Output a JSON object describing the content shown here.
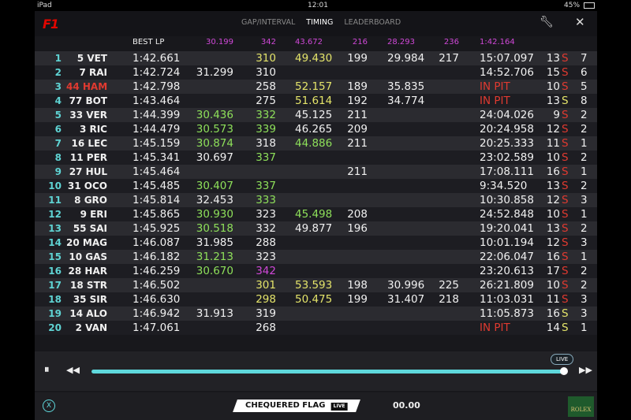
{
  "status": {
    "device": "iPad",
    "time": "12:01",
    "battery": "45%"
  },
  "header": {
    "logo": "F1",
    "tabs": [
      "GAP/INTERVAL",
      "TIMING",
      "LEADERBOARD"
    ],
    "active_tab": "TIMING"
  },
  "columns": {
    "best": "BEST LP",
    "s1": "30.199",
    "sp1": "342",
    "s2": "43.672",
    "sp2": "216",
    "s3": "28.293",
    "sp3": "236",
    "last": "1:42.164"
  },
  "colors": {
    "white": "#f0f0f0",
    "green": "#8ee05a",
    "yellow": "#e4e46a",
    "purple": "#d048d8",
    "red": "#e03a30",
    "accent": "#5fd8dc"
  },
  "rows": [
    {
      "pos": "1",
      "drv": "5 VET",
      "best": "1:42.661",
      "s1": [
        "",
        ""
      ],
      "sp1": [
        "310",
        "yellow"
      ],
      "s2": [
        "49.430",
        "yellow"
      ],
      "sp2": "199",
      "s3": "29.984",
      "sp3": "217",
      "last": [
        "15:07.097",
        "white"
      ],
      "laps": "13",
      "tyre": [
        "S",
        "red"
      ],
      "stint": "7"
    },
    {
      "pos": "2",
      "drv": "7 RAI",
      "best": "1:42.724",
      "s1": [
        "31.299",
        "white"
      ],
      "sp1": [
        "310",
        "white"
      ],
      "s2": [
        "",
        ""
      ],
      "sp2": "",
      "s3": "",
      "sp3": "",
      "last": [
        "14:52.706",
        "white"
      ],
      "laps": "15",
      "tyre": [
        "S",
        "red"
      ],
      "stint": "6"
    },
    {
      "pos": "3",
      "drv": "44 HAM",
      "drv_color": "red",
      "best": "1:42.798",
      "s1": [
        "",
        ""
      ],
      "sp1": [
        "258",
        "white"
      ],
      "s2": [
        "52.157",
        "yellow"
      ],
      "sp2": "189",
      "s3": "35.835",
      "sp3": "",
      "last": [
        "IN PIT",
        "red"
      ],
      "laps": "10",
      "tyre": [
        "S",
        "red"
      ],
      "stint": "5"
    },
    {
      "pos": "4",
      "drv": "77 BOT",
      "best": "1:43.464",
      "s1": [
        "",
        ""
      ],
      "sp1": [
        "275",
        "white"
      ],
      "s2": [
        "51.614",
        "yellow"
      ],
      "sp2": "192",
      "s3": "34.774",
      "sp3": "",
      "last": [
        "IN PIT",
        "red"
      ],
      "laps": "13",
      "tyre": [
        "S",
        "yellow"
      ],
      "stint": "8"
    },
    {
      "pos": "5",
      "drv": "33 VER",
      "best": "1:44.399",
      "s1": [
        "30.436",
        "green"
      ],
      "sp1": [
        "332",
        "green"
      ],
      "s2": [
        "45.125",
        "white"
      ],
      "sp2": "211",
      "s3": "",
      "sp3": "",
      "last": [
        "24:04.026",
        "white"
      ],
      "laps": "9",
      "tyre": [
        "S",
        "red"
      ],
      "stint": "2"
    },
    {
      "pos": "6",
      "drv": "3 RIC",
      "best": "1:44.479",
      "s1": [
        "30.573",
        "green"
      ],
      "sp1": [
        "339",
        "green"
      ],
      "s2": [
        "46.265",
        "white"
      ],
      "sp2": "209",
      "s3": "",
      "sp3": "",
      "last": [
        "20:24.958",
        "white"
      ],
      "laps": "12",
      "tyre": [
        "S",
        "red"
      ],
      "stint": "2"
    },
    {
      "pos": "7",
      "drv": "16 LEC",
      "best": "1:45.159",
      "s1": [
        "30.874",
        "green"
      ],
      "sp1": [
        "318",
        "white"
      ],
      "s2": [
        "44.886",
        "green"
      ],
      "sp2": "211",
      "s3": "",
      "sp3": "",
      "last": [
        "20:25.333",
        "white"
      ],
      "laps": "11",
      "tyre": [
        "S",
        "red"
      ],
      "stint": "1"
    },
    {
      "pos": "8",
      "drv": "11 PER",
      "best": "1:45.341",
      "s1": [
        "30.697",
        "white"
      ],
      "sp1": [
        "337",
        "green"
      ],
      "s2": [
        "",
        ""
      ],
      "sp2": "",
      "s3": "",
      "sp3": "",
      "last": [
        "23:02.589",
        "white"
      ],
      "laps": "10",
      "tyre": [
        "S",
        "red"
      ],
      "stint": "2"
    },
    {
      "pos": "9",
      "drv": "27 HUL",
      "best": "1:45.464",
      "s1": [
        "",
        ""
      ],
      "sp1": [
        "",
        ""
      ],
      "s2": [
        "",
        ""
      ],
      "sp2": "211",
      "s3": "",
      "sp3": "",
      "last": [
        "17:08.111",
        "white"
      ],
      "laps": "16",
      "tyre": [
        "S",
        "red"
      ],
      "stint": "1"
    },
    {
      "pos": "10",
      "drv": "31 OCO",
      "best": "1:45.485",
      "s1": [
        "30.407",
        "green"
      ],
      "sp1": [
        "337",
        "green"
      ],
      "s2": [
        "",
        ""
      ],
      "sp2": "",
      "s3": "",
      "sp3": "",
      "last": [
        "9:34.520",
        "white"
      ],
      "laps": "13",
      "tyre": [
        "S",
        "red"
      ],
      "stint": "2"
    },
    {
      "pos": "11",
      "drv": "8 GRO",
      "best": "1:45.814",
      "s1": [
        "32.453",
        "white"
      ],
      "sp1": [
        "333",
        "green"
      ],
      "s2": [
        "",
        ""
      ],
      "sp2": "",
      "s3": "",
      "sp3": "",
      "last": [
        "10:30.858",
        "white"
      ],
      "laps": "12",
      "tyre": [
        "S",
        "red"
      ],
      "stint": "3"
    },
    {
      "pos": "12",
      "drv": "9 ERI",
      "best": "1:45.865",
      "s1": [
        "30.930",
        "green"
      ],
      "sp1": [
        "323",
        "white"
      ],
      "s2": [
        "45.498",
        "green"
      ],
      "sp2": "208",
      "s3": "",
      "sp3": "",
      "last": [
        "24:52.848",
        "white"
      ],
      "laps": "10",
      "tyre": [
        "S",
        "red"
      ],
      "stint": "1"
    },
    {
      "pos": "13",
      "drv": "55 SAI",
      "best": "1:45.925",
      "s1": [
        "30.518",
        "green"
      ],
      "sp1": [
        "332",
        "white"
      ],
      "s2": [
        "49.877",
        "white"
      ],
      "sp2": "196",
      "s3": "",
      "sp3": "",
      "last": [
        "19:20.041",
        "white"
      ],
      "laps": "13",
      "tyre": [
        "S",
        "red"
      ],
      "stint": "2"
    },
    {
      "pos": "14",
      "drv": "20 MAG",
      "best": "1:46.087",
      "s1": [
        "31.985",
        "white"
      ],
      "sp1": [
        "288",
        "white"
      ],
      "s2": [
        "",
        ""
      ],
      "sp2": "",
      "s3": "",
      "sp3": "",
      "last": [
        "10:01.194",
        "white"
      ],
      "laps": "12",
      "tyre": [
        "S",
        "red"
      ],
      "stint": "3"
    },
    {
      "pos": "15",
      "drv": "10 GAS",
      "best": "1:46.182",
      "s1": [
        "31.213",
        "green"
      ],
      "sp1": [
        "323",
        "white"
      ],
      "s2": [
        "",
        ""
      ],
      "sp2": "",
      "s3": "",
      "sp3": "",
      "last": [
        "22:06.047",
        "white"
      ],
      "laps": "16",
      "tyre": [
        "S",
        "red"
      ],
      "stint": "1"
    },
    {
      "pos": "16",
      "drv": "28 HAR",
      "best": "1:46.259",
      "s1": [
        "30.670",
        "green"
      ],
      "sp1": [
        "342",
        "purple"
      ],
      "s2": [
        "",
        ""
      ],
      "sp2": "",
      "s3": "",
      "sp3": "",
      "last": [
        "23:20.613",
        "white"
      ],
      "laps": "17",
      "tyre": [
        "S",
        "red"
      ],
      "stint": "2"
    },
    {
      "pos": "17",
      "drv": "18 STR",
      "best": "1:46.502",
      "s1": [
        "",
        ""
      ],
      "sp1": [
        "301",
        "yellow"
      ],
      "s2": [
        "53.593",
        "yellow"
      ],
      "sp2": "198",
      "s3": "30.996",
      "sp3": "225",
      "last": [
        "26:21.809",
        "white"
      ],
      "laps": "10",
      "tyre": [
        "S",
        "red"
      ],
      "stint": "2"
    },
    {
      "pos": "18",
      "drv": "35 SIR",
      "best": "1:46.630",
      "s1": [
        "",
        ""
      ],
      "sp1": [
        "298",
        "yellow"
      ],
      "s2": [
        "50.475",
        "yellow"
      ],
      "sp2": "199",
      "s3": "31.407",
      "sp3": "218",
      "last": [
        "11:03.031",
        "white"
      ],
      "laps": "11",
      "tyre": [
        "S",
        "red"
      ],
      "stint": "3"
    },
    {
      "pos": "19",
      "drv": "14 ALO",
      "best": "1:46.942",
      "s1": [
        "31.913",
        "white"
      ],
      "sp1": [
        "319",
        "white"
      ],
      "s2": [
        "",
        ""
      ],
      "sp2": "",
      "s3": "",
      "sp3": "",
      "last": [
        "11:05.873",
        "white"
      ],
      "laps": "16",
      "tyre": [
        "S",
        "yellow"
      ],
      "stint": "3"
    },
    {
      "pos": "20",
      "drv": "2 VAN",
      "best": "1:47.061",
      "s1": [
        "",
        ""
      ],
      "sp1": [
        "268",
        "white"
      ],
      "s2": [
        "",
        ""
      ],
      "sp2": "",
      "s3": "",
      "sp3": "",
      "last": [
        "IN PIT",
        "red"
      ],
      "laps": "14",
      "tyre": [
        "S",
        "yellow"
      ],
      "stint": "1"
    }
  ],
  "playback": {
    "live_label": "LIVE",
    "progress_percent": 100
  },
  "footer": {
    "flag": "CHEQUERED FLAG",
    "flag_live": "LIVE",
    "clock": "00.00",
    "sponsor": "ROLEX",
    "left_icon": "X"
  }
}
